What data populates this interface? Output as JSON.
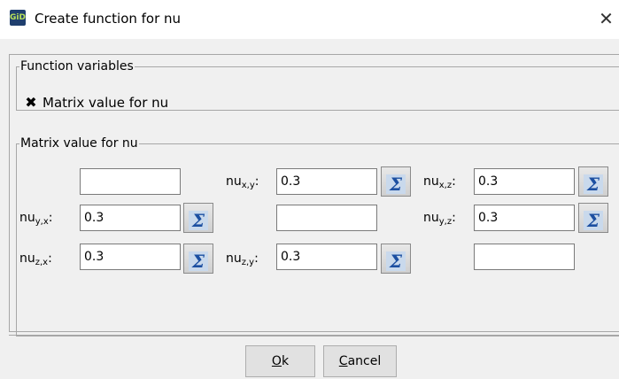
{
  "window": {
    "title": "Create function for nu",
    "app_icon_text": "GiD",
    "close_glyph": "✕"
  },
  "function_variables": {
    "legend": "Function variables",
    "checkbox": {
      "label": "Matrix value for nu",
      "checked": true
    }
  },
  "matrix": {
    "legend": "Matrix value for nu",
    "base": "nu",
    "cells": {
      "xx": {
        "value": "",
        "label": ""
      },
      "xy": {
        "value": "0.3",
        "label_sub": "x,y",
        "label_suffix": ":"
      },
      "xz": {
        "value": "0.3",
        "label_sub": "x,z",
        "label_suffix": ":"
      },
      "yx": {
        "value": "0.3",
        "label_sub": "y,x",
        "label_suffix": ":"
      },
      "yy": {
        "value": "",
        "label": ""
      },
      "yz": {
        "value": "0.3",
        "label_sub": "y,z",
        "label_suffix": ":"
      },
      "zx": {
        "value": "0.3",
        "label_sub": "z,x",
        "label_suffix": ":"
      },
      "zy": {
        "value": "0.3",
        "label_sub": "z,y",
        "label_suffix": ":"
      },
      "zz": {
        "value": "",
        "label": ""
      }
    },
    "edit_icon": "sigma-icon",
    "sigma_glyph": "Σ"
  },
  "buttons": {
    "ok_mnemonic": "O",
    "ok_rest": "k",
    "cancel_mnemonic": "C",
    "cancel_rest": "ancel"
  },
  "colors": {
    "icon_bg": "#1f3f6e",
    "sigma_blue": "#1c4fa1",
    "border": "#a7a7a7",
    "background": "#f0f0f0"
  }
}
